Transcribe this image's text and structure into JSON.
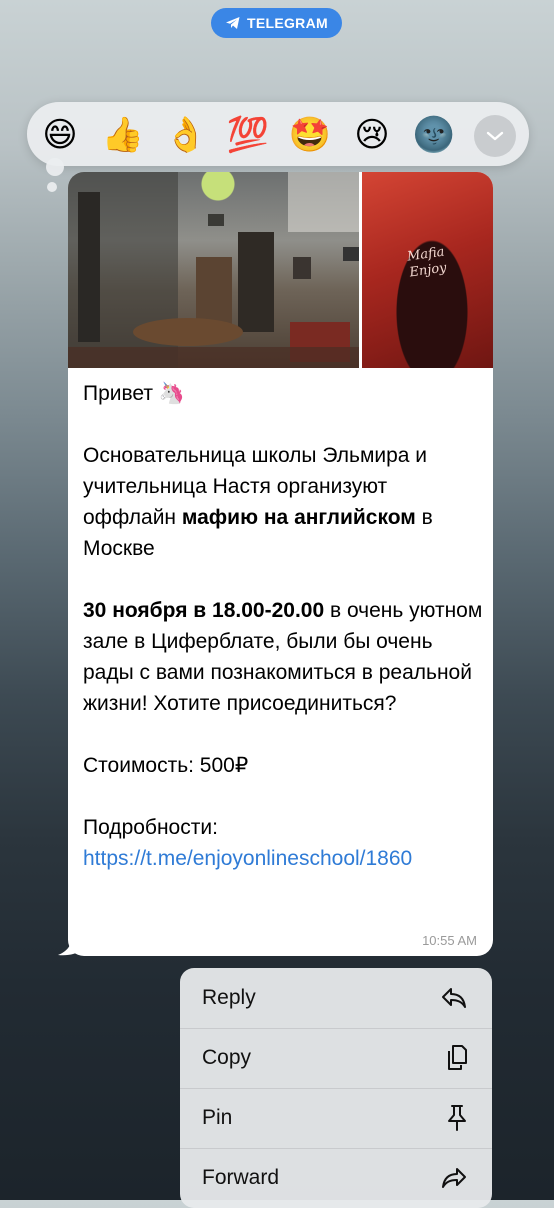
{
  "header": {
    "badge_label": "TELEGRAM"
  },
  "reactions": {
    "items": [
      "😄",
      "👍",
      "👌",
      "💯",
      "🤩",
      "😢",
      "🌚"
    ],
    "more_icon": "chevron-down-icon"
  },
  "message": {
    "greeting": "Привет 🦄",
    "para1_pre": "Основательница школы Эльмира и учительница Настя организуют оффлайн ",
    "para1_bold": "мафию на английском",
    "para1_post": " в Москве",
    "para2_bold": "30 ноября в 18.00-20.00",
    "para2_post": " в очень уютном зале в Циферблате, были бы очень рады с вами познакомиться в реальной жизни! Хотите присоединиться?",
    "price": "Стоимость: 500₽",
    "details_label": "Подробности:",
    "details_link": "https://t.me/enjoyonlineschool/1860",
    "time": "10:55 AM",
    "photo2_logo": "Mafia Enjoy"
  },
  "context_menu": {
    "items": [
      {
        "label": "Reply",
        "icon": "reply-icon"
      },
      {
        "label": "Copy",
        "icon": "copy-icon"
      },
      {
        "label": "Pin",
        "icon": "pin-icon"
      },
      {
        "label": "Forward",
        "icon": "forward-icon"
      }
    ]
  },
  "colors": {
    "accent": "#3a86e6",
    "link": "#2f7bd6",
    "bubble": "#ffffff"
  }
}
